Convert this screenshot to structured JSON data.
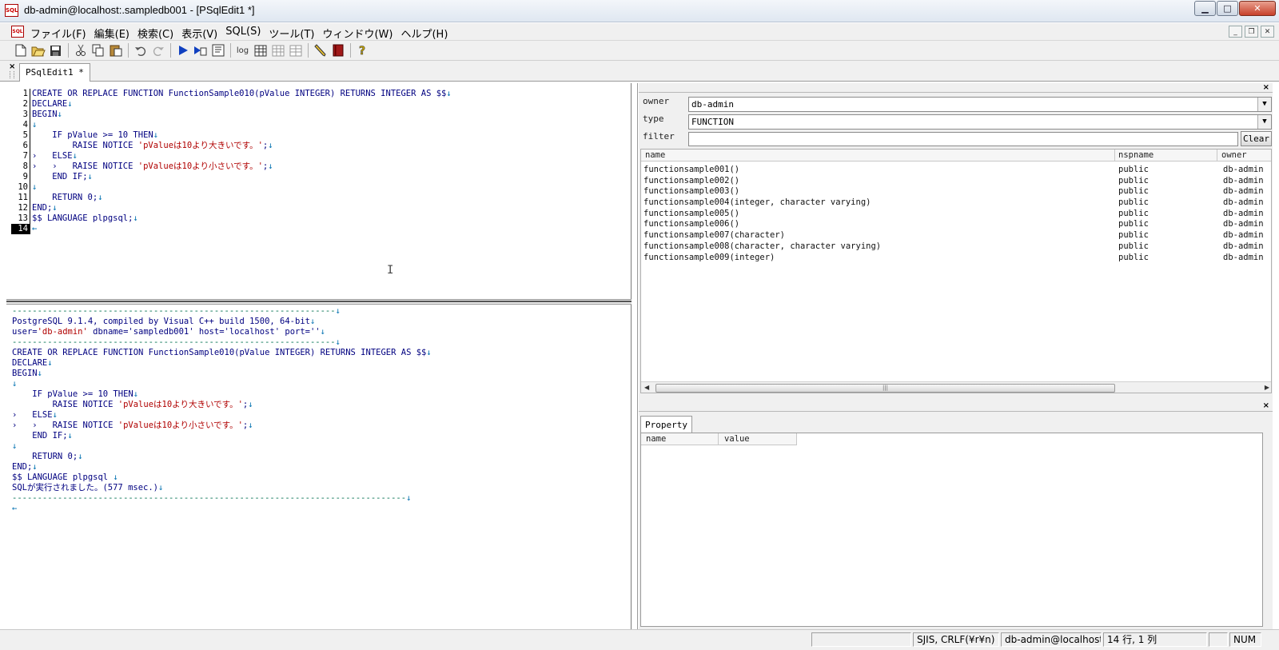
{
  "window": {
    "app_icon_text": "SQL",
    "title": "db-admin@localhost:.sampledb001 - [PSqlEdit1 *]",
    "controls": {
      "minimize": "▁",
      "maximize": "□",
      "close": "✕"
    }
  },
  "menubar": {
    "doc_icon_text": "SQL",
    "items": [
      "ファイル(F)",
      "編集(E)",
      "検索(C)",
      "表示(V)",
      "SQL(S)",
      "ツール(T)",
      "ウィンドウ(W)",
      "ヘルプ(H)"
    ],
    "mdi_controls": {
      "minimize": "_",
      "restore": "❐",
      "close": "✕"
    }
  },
  "toolbar": {
    "log_label": "log",
    "icons": [
      "new-file-icon",
      "open-folder-icon",
      "save-icon",
      "cut-icon",
      "copy-icon",
      "paste-icon",
      "undo-icon",
      "redo-icon",
      "run-icon",
      "run-step-icon",
      "explain-icon",
      "log-icon",
      "grid-icon",
      "grid-icon-2",
      "grid-icon-3",
      "pencil-icon",
      "book-icon",
      "help-icon"
    ]
  },
  "tabs": {
    "close_glyph": "×",
    "active_tab": "PSqlEdit1 *"
  },
  "editor": {
    "line_numbers": [
      "1",
      "2",
      "3",
      "4",
      "5",
      "6",
      "7",
      "8",
      "9",
      "10",
      "11",
      "12",
      "13",
      "14"
    ],
    "current_line": "14",
    "lines": [
      {
        "a": "CREATE OR REPLACE FUNCTION FunctionSample010(pValue INTEGER) RETURNS INTEGER AS $$",
        "s": "",
        "b": "",
        "m": "↓"
      },
      {
        "a": "DECLARE",
        "s": "",
        "b": "",
        "m": "↓"
      },
      {
        "a": "BEGIN",
        "s": "",
        "b": "",
        "m": "↓"
      },
      {
        "a": "",
        "s": "",
        "b": "",
        "m": "↓"
      },
      {
        "a": "    IF pValue >= 10 THEN",
        "s": "",
        "b": "",
        "m": "↓"
      },
      {
        "a": "        RAISE NOTICE ",
        "s": "'pValueは10より大きいです。'",
        "b": ";",
        "m": "↓"
      },
      {
        "a": "›   ELSE",
        "s": "",
        "b": "",
        "m": "↓"
      },
      {
        "a": "›   ›   RAISE NOTICE ",
        "s": "'pValueは10より小さいです。'",
        "b": ";",
        "m": "↓"
      },
      {
        "a": "    END IF;",
        "s": "",
        "b": "",
        "m": "↓"
      },
      {
        "a": "",
        "s": "",
        "b": "",
        "m": "↓"
      },
      {
        "a": "    RETURN 0;",
        "s": "",
        "b": "",
        "m": "↓"
      },
      {
        "a": "END;",
        "s": "",
        "b": "",
        "m": "↓"
      },
      {
        "a": "$$ LANGUAGE plpgsql;",
        "s": "",
        "b": "",
        "m": "↓"
      },
      {
        "a": "",
        "s": "",
        "b": "",
        "m": "←"
      }
    ]
  },
  "output": {
    "lines": [
      {
        "a": "----------------------------------------------------------------",
        "s": "",
        "b": "",
        "m": "↓",
        "dash": true
      },
      {
        "a": "PostgreSQL 9.1.4, compiled by Visual C++ build 1500, 64-bit",
        "s": "",
        "b": "",
        "m": "↓"
      },
      {
        "a": "user=",
        "s": "'db-admin'",
        "b": " dbname='sampledb001' host='localhost' port=''",
        "m": "↓"
      },
      {
        "a": "----------------------------------------------------------------",
        "s": "",
        "b": "",
        "m": "↓",
        "dash": true
      },
      {
        "a": "CREATE OR REPLACE FUNCTION FunctionSample010(pValue INTEGER) RETURNS INTEGER AS $$",
        "s": "",
        "b": "",
        "m": "↓"
      },
      {
        "a": "DECLARE",
        "s": "",
        "b": "",
        "m": "↓"
      },
      {
        "a": "BEGIN",
        "s": "",
        "b": "",
        "m": "↓"
      },
      {
        "a": "",
        "s": "",
        "b": "",
        "m": "↓"
      },
      {
        "a": "    IF pValue >= 10 THEN",
        "s": "",
        "b": "",
        "m": "↓"
      },
      {
        "a": "        RAISE NOTICE ",
        "s": "'pValueは10より大きいです。'",
        "b": ";",
        "m": "↓"
      },
      {
        "a": "›   ELSE",
        "s": "",
        "b": "",
        "m": "↓"
      },
      {
        "a": "›   ›   RAISE NOTICE ",
        "s": "'pValueは10より小さいです。'",
        "b": ";",
        "m": "↓"
      },
      {
        "a": "    END IF;",
        "s": "",
        "b": "",
        "m": "↓"
      },
      {
        "a": "",
        "s": "",
        "b": "",
        "m": "↓"
      },
      {
        "a": "    RETURN 0;",
        "s": "",
        "b": "",
        "m": "↓"
      },
      {
        "a": "END;",
        "s": "",
        "b": "",
        "m": "↓"
      },
      {
        "a": "$$ LANGUAGE plpgsql ",
        "s": "",
        "b": "",
        "m": "↓"
      },
      {
        "a": "SQLが実行されました。(577 msec.)",
        "s": "",
        "b": "",
        "m": "↓"
      },
      {
        "a": "------------------------------------------------------------------------------",
        "s": "",
        "b": "",
        "m": "↓",
        "dash": true
      },
      {
        "a": "",
        "s": "",
        "b": "",
        "m": "←"
      }
    ]
  },
  "object_browser": {
    "close_glyph": "×",
    "owner_label": "owner",
    "owner_value": "db-admin",
    "type_label": "type",
    "type_value": "FUNCTION",
    "filter_label": "filter",
    "filter_value": "",
    "clear_button": "Clear",
    "columns": [
      "name",
      "nspname",
      "owner"
    ],
    "rows": [
      {
        "name": "functionsample001()",
        "nspname": "public",
        "owner": "db-admin"
      },
      {
        "name": "functionsample002()",
        "nspname": "public",
        "owner": "db-admin"
      },
      {
        "name": "functionsample003()",
        "nspname": "public",
        "owner": "db-admin"
      },
      {
        "name": "functionsample004(integer, character varying)",
        "nspname": "public",
        "owner": "db-admin"
      },
      {
        "name": "functionsample005()",
        "nspname": "public",
        "owner": "db-admin"
      },
      {
        "name": "functionsample006()",
        "nspname": "public",
        "owner": "db-admin"
      },
      {
        "name": "functionsample007(character)",
        "nspname": "public",
        "owner": "db-admin"
      },
      {
        "name": "functionsample008(character, character varying)",
        "nspname": "public",
        "owner": "db-admin"
      },
      {
        "name": "functionsample009(integer)",
        "nspname": "public",
        "owner": "db-admin"
      }
    ],
    "scroll_left": "◀",
    "scroll_right": "▶",
    "scroll_thumb_grip": "|||"
  },
  "property_panel": {
    "close_glyph": "×",
    "tab_label": "Property",
    "columns": [
      "name",
      "value"
    ]
  },
  "statusbar": {
    "encoding": "SJIS, CRLF(¥r¥n)",
    "connection": "db-admin@localhost:",
    "position": "14 行, 1 列",
    "num": "NUM"
  }
}
